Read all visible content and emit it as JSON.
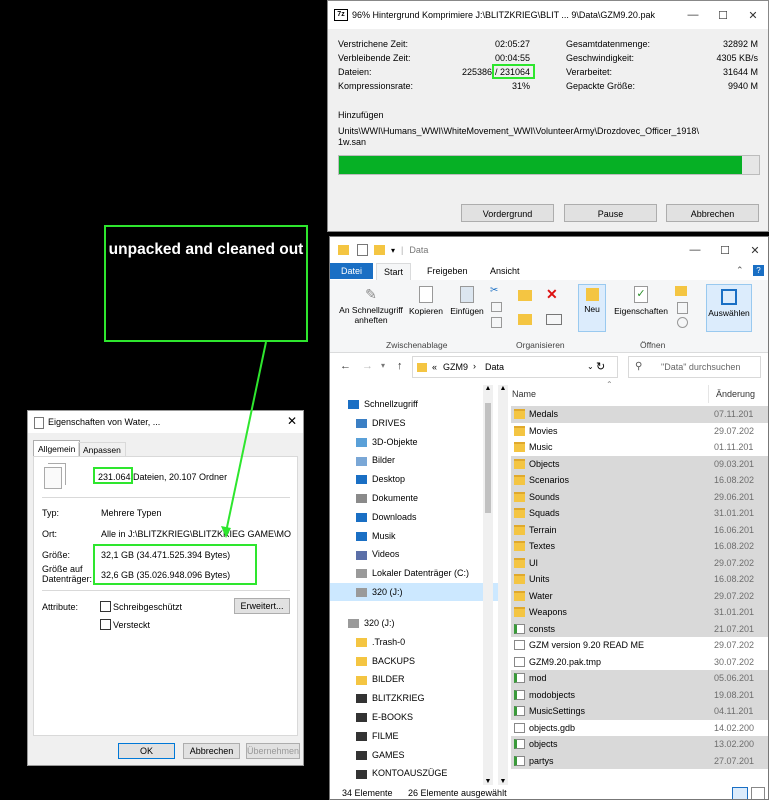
{
  "zip": {
    "title": "96% Hintergrund Komprimiere J:\\BLITZKRIEG\\BLIT ... 9\\Data\\GZM9.20.pak",
    "elapsed_label": "Verstrichene Zeit:",
    "elapsed": "02:05:27",
    "remaining_label": "Verbleibende Zeit:",
    "remaining": "00:04:55",
    "files_label": "Dateien:",
    "files_done": "225386",
    "files_total": "/ 231064",
    "ratio_label": "Kompressionsrate:",
    "ratio": "31%",
    "total_label": "Gesamtdatenmenge:",
    "total": "32892 M",
    "speed_label": "Geschwindigkeit:",
    "speed": "4305 KB/s",
    "processed_label": "Verarbeitet:",
    "processed": "31644 M",
    "packed_label": "Gepackte Größe:",
    "packed": "9940 M",
    "action": "Hinzufügen",
    "path1": "Units\\WWI\\Humans_WWI\\WhiteMovement_WWI\\VolunteerArmy\\Drozdovec_Officer_1918\\",
    "path2": "1w.san",
    "progress": 0.96,
    "btn_foreground": "Vordergrund",
    "btn_pause": "Pause",
    "btn_cancel": "Abbrechen"
  },
  "explorer": {
    "title": "Data",
    "tabs": [
      "Datei",
      "Start",
      "Freigeben",
      "Ansicht"
    ],
    "ribbon": {
      "pin": "An Schnellzugriff\nanheften",
      "copy": "Kopieren",
      "paste": "Einfügen",
      "new": "Neu",
      "props": "Eigenschaften",
      "select": "Auswählen",
      "grp_clip": "Zwischenablage",
      "grp_org": "Organisieren",
      "grp_open": "Öffnen"
    },
    "address": [
      "GZM9",
      "Data"
    ],
    "address_prefix": "«",
    "search_placeholder": "\"Data\" durchsuchen",
    "col_name": "Name",
    "col_date": "Änderung",
    "nav_top": [
      {
        "label": "Schnellzugriff",
        "icon": "star-icon"
      },
      {
        "label": "DRIVES",
        "icon": "computer-icon"
      },
      {
        "label": "3D-Objekte",
        "icon": "cube-icon"
      },
      {
        "label": "Bilder",
        "icon": "pictures-icon"
      },
      {
        "label": "Desktop",
        "icon": "desktop-icon"
      },
      {
        "label": "Dokumente",
        "icon": "documents-icon"
      },
      {
        "label": "Downloads",
        "icon": "download-icon"
      },
      {
        "label": "Musik",
        "icon": "music-icon"
      },
      {
        "label": "Videos",
        "icon": "video-icon"
      },
      {
        "label": "Lokaler Datenträger (C:)",
        "icon": "drive-icon"
      },
      {
        "label": "320 (J:)",
        "icon": "drive-icon"
      }
    ],
    "nav_bottom": [
      {
        "label": "320 (J:)",
        "icon": "drive-icon"
      },
      {
        "label": ".Trash-0",
        "icon": "folder-icon"
      },
      {
        "label": "BACKUPS",
        "icon": "folder-icon"
      },
      {
        "label": "BILDER",
        "icon": "folder-icon"
      },
      {
        "label": "BLITZKRIEG",
        "icon": "film-icon"
      },
      {
        "label": "E-BOOKS",
        "icon": "film-icon"
      },
      {
        "label": "FILME",
        "icon": "film-icon"
      },
      {
        "label": "GAMES",
        "icon": "film-icon"
      },
      {
        "label": "KONTOAUSZÜGE",
        "icon": "film-icon"
      }
    ],
    "files": [
      {
        "name": "Medals",
        "date": "07.11.201",
        "type": "folder",
        "sel": true
      },
      {
        "name": "Movies",
        "date": "29.07.202",
        "type": "folder",
        "sel": false
      },
      {
        "name": "Music",
        "date": "01.11.201",
        "type": "folder",
        "sel": false
      },
      {
        "name": "Objects",
        "date": "09.03.201",
        "type": "folder",
        "sel": true
      },
      {
        "name": "Scenarios",
        "date": "16.08.202",
        "type": "folder",
        "sel": true
      },
      {
        "name": "Sounds",
        "date": "29.06.201",
        "type": "folder",
        "sel": true
      },
      {
        "name": "Squads",
        "date": "31.01.201",
        "type": "folder",
        "sel": true
      },
      {
        "name": "Terrain",
        "date": "16.06.201",
        "type": "folder",
        "sel": true
      },
      {
        "name": "Textes",
        "date": "16.08.202",
        "type": "folder",
        "sel": true
      },
      {
        "name": "UI",
        "date": "29.07.202",
        "type": "folder",
        "sel": true
      },
      {
        "name": "Units",
        "date": "16.08.202",
        "type": "folder",
        "sel": true
      },
      {
        "name": "Water",
        "date": "29.07.202",
        "type": "folder",
        "sel": true
      },
      {
        "name": "Weapons",
        "date": "31.01.201",
        "type": "folder",
        "sel": true
      },
      {
        "name": "consts",
        "date": "21.07.201",
        "type": "shot",
        "sel": true
      },
      {
        "name": "GZM version 9.20 READ ME",
        "date": "29.07.202",
        "type": "doc",
        "sel": false
      },
      {
        "name": "GZM9.20.pak.tmp",
        "date": "30.07.202",
        "type": "doc",
        "sel": false
      },
      {
        "name": "mod",
        "date": "05.06.201",
        "type": "shot",
        "sel": true
      },
      {
        "name": "modobjects",
        "date": "19.08.201",
        "type": "shot",
        "sel": true
      },
      {
        "name": "MusicSettings",
        "date": "04.11.201",
        "type": "shot",
        "sel": true
      },
      {
        "name": "objects.gdb",
        "date": "14.02.200",
        "type": "doc",
        "sel": false
      },
      {
        "name": "objects",
        "date": "13.02.200",
        "type": "shot",
        "sel": true
      },
      {
        "name": "partys",
        "date": "27.07.201",
        "type": "shot",
        "sel": true
      }
    ],
    "status_count": "34 Elemente",
    "status_sel": "26 Elemente ausgewählt"
  },
  "props": {
    "title": "Eigenschaften von Water, ...",
    "tab_general": "Allgemein",
    "tab_custom": "Anpassen",
    "count": "231.064",
    "count_rest": "Dateien, 20.107 Ordner",
    "type_label": "Typ:",
    "type_value": "Mehrere Typen",
    "loc_label": "Ort:",
    "loc_value": "Alle in J:\\BLITZKRIEG\\BLITZKRIEG GAME\\MODS\\GZ",
    "size_label": "Größe:",
    "size_value": "32,1 GB (34.471.525.394 Bytes)",
    "disk_label": "Größe auf\nDatenträger:",
    "disk_value": "32,6 GB (35.026.948.096 Bytes)",
    "attr_label": "Attribute:",
    "readonly": "Schreibgeschützt",
    "hidden": "Versteckt",
    "advanced": "Erweitert...",
    "ok": "OK",
    "cancel": "Abbrechen",
    "apply": "Übernehmen"
  },
  "annotation": "unpacked and cleaned out",
  "colors": {
    "highlight": "#2ee62e",
    "progress": "#06b025",
    "selection": "#d9d9d9",
    "ribbon_blue": "#1a6fc4"
  }
}
